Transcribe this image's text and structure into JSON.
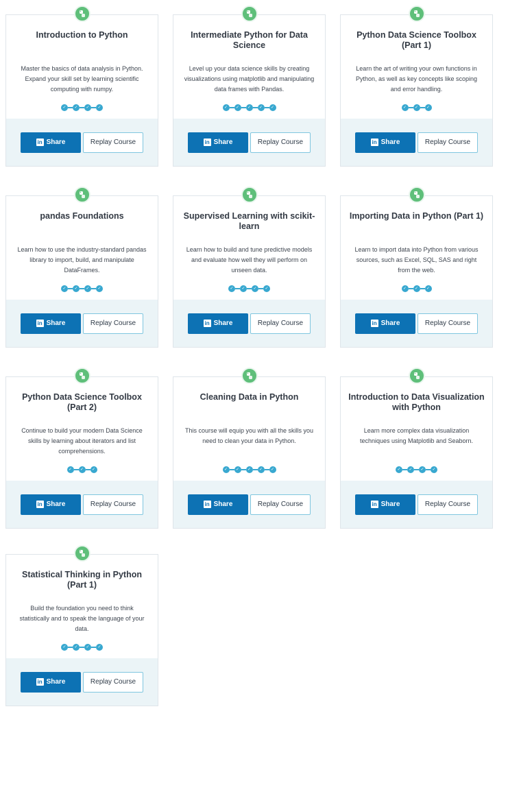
{
  "actions": {
    "share_label": "Share",
    "replay_label": "Replay Course",
    "share_icon_text": "in"
  },
  "colors": {
    "badge": "#5fbf7a",
    "chapter_dot": "#38a8d0",
    "share_button": "#0d72b4",
    "footer_bg": "#ebf4f7"
  },
  "icons": {
    "badge": "python-logo-icon",
    "chapter": "check-circle-icon",
    "share": "linkedin-icon"
  },
  "courses": [
    {
      "title": "Introduction to Python",
      "description": "Master the basics of data analysis in Python. Expand your skill set by learning scientific computing with numpy.",
      "chapters": 4
    },
    {
      "title": "Intermediate Python for Data Science",
      "description": "Level up your data science skills by creating visualizations using matplotlib and manipulating data frames with Pandas.",
      "chapters": 5
    },
    {
      "title": "Python Data Science Toolbox (Part 1)",
      "description": "Learn the art of writing your own functions in Python, as well as key concepts like scoping and error handling.",
      "chapters": 3
    },
    {
      "title": "pandas Foundations",
      "description": "Learn how to use the industry-standard pandas library to import, build, and manipulate DataFrames.",
      "chapters": 4
    },
    {
      "title": "Supervised Learning with scikit-learn",
      "description": "Learn how to build and tune predictive models and evaluate how well they will perform on unseen data.",
      "chapters": 4
    },
    {
      "title": "Importing Data in Python (Part 1)",
      "description": "Learn to import data into Python from various sources, such as Excel, SQL, SAS and right from the web.",
      "chapters": 3
    },
    {
      "title": "Python Data Science Toolbox (Part 2)",
      "description": "Continue to build your modern Data Science skills by learning about iterators and list comprehensions.",
      "chapters": 3
    },
    {
      "title": "Cleaning Data in Python",
      "description": "This course will equip you with all the skills you need to clean your data in Python.",
      "chapters": 5
    },
    {
      "title": "Introduction to Data Visualization with Python",
      "description": "Learn more complex data visualization techniques using Matplotlib and Seaborn.",
      "chapters": 4
    },
    {
      "title": "Statistical Thinking in Python (Part 1)",
      "description": "Build the foundation you need to think statistically and to speak the language of your data.",
      "chapters": 4
    }
  ]
}
